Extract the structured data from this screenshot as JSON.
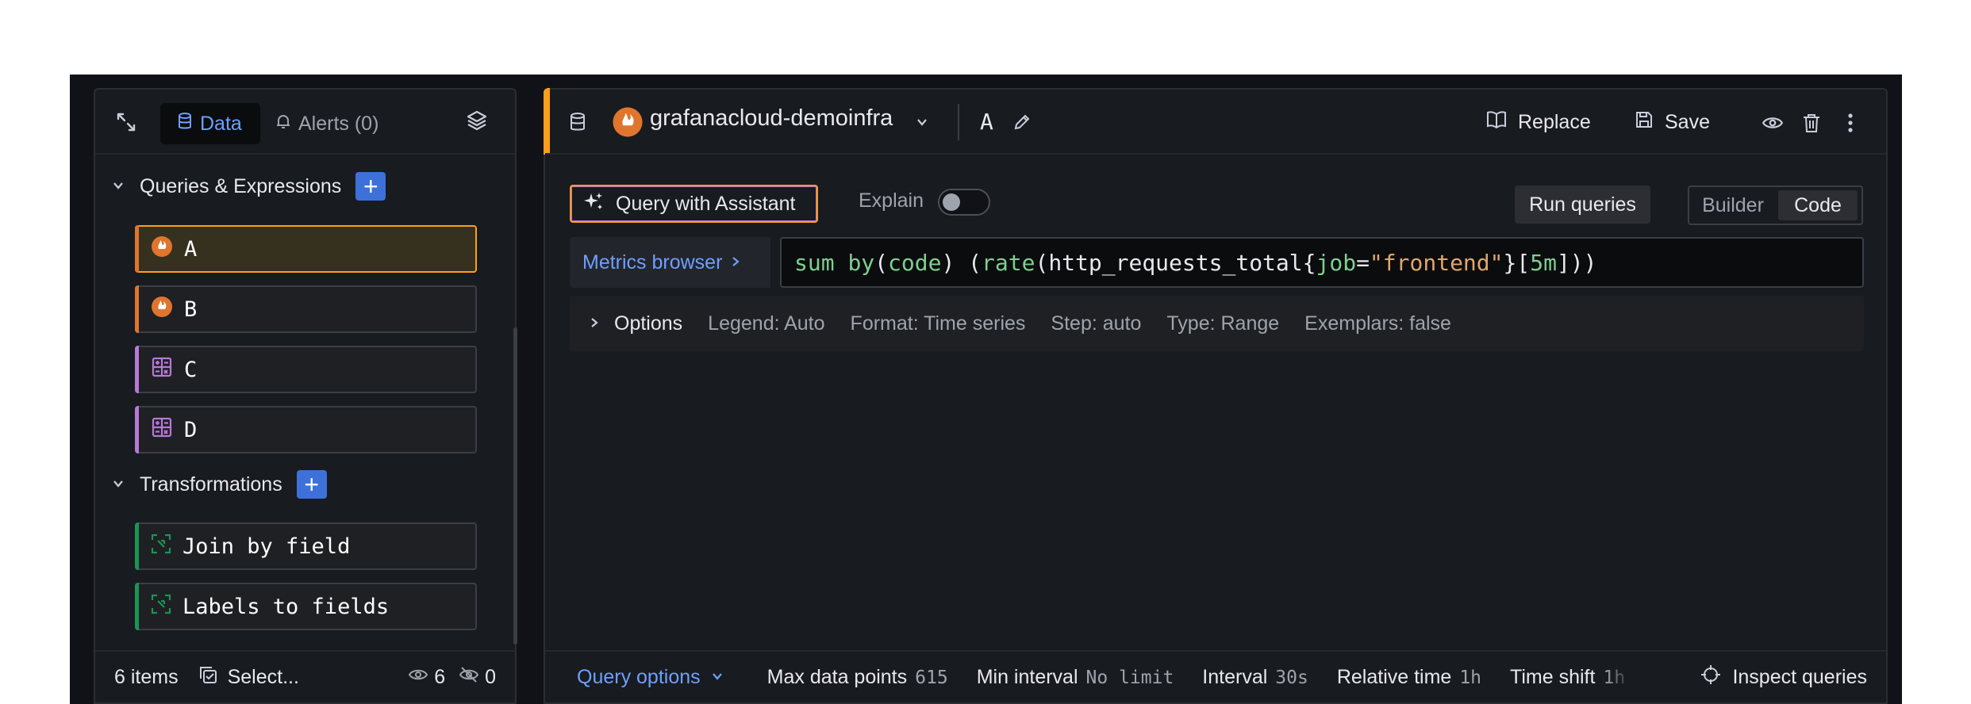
{
  "colors": {
    "accent": "#6e9fff",
    "selected_border": "#ff9e1a",
    "prometheus": "#e0752d",
    "expression": "#b877d9",
    "transformation": "#1a9456",
    "primary_button": "#3d71d9"
  },
  "left_panel": {
    "tabs": {
      "data_label": "Data",
      "alerts_label": "Alerts (0)"
    },
    "queries_section": {
      "title": "Queries & Expressions"
    },
    "queries": [
      {
        "label": "A",
        "icon": "prometheus-icon",
        "selected": true
      },
      {
        "label": "B",
        "icon": "prometheus-icon",
        "selected": false
      },
      {
        "label": "C",
        "icon": "math-expression-icon",
        "selected": false
      },
      {
        "label": "D",
        "icon": "math-expression-icon",
        "selected": false
      }
    ],
    "transformations_section": {
      "title": "Transformations"
    },
    "transformations": [
      {
        "label": "Join by field",
        "icon": "transform-icon"
      },
      {
        "label": "Labels to fields",
        "icon": "transform-icon"
      }
    ],
    "footer": {
      "count": "6 items",
      "select_label": "Select...",
      "visible_count": "6",
      "hidden_count": "0"
    }
  },
  "query_editor": {
    "datasource": "grafanacloud-demoinfra",
    "query_name": "A",
    "header_actions": {
      "replace": "Replace",
      "save": "Save"
    },
    "assistant_button": "Query with Assistant",
    "explain_label": "Explain",
    "explain_enabled": false,
    "run_queries": "Run queries",
    "mode": {
      "builder": "Builder",
      "code": "Code",
      "active": "Code"
    },
    "metrics_browser": "Metrics browser",
    "query_tokens": [
      {
        "text": "sum ",
        "color": "#7ecf90"
      },
      {
        "text": "by",
        "color": "#7ecf90"
      },
      {
        "text": "(",
        "color": "#e8e8ee"
      },
      {
        "text": "code",
        "color": "#7ecf90"
      },
      {
        "text": ") (",
        "color": "#e8e8ee"
      },
      {
        "text": "rate",
        "color": "#7ecf90"
      },
      {
        "text": "(http_requests_total{",
        "color": "#e8e8ee"
      },
      {
        "text": "job",
        "color": "#7ecf90"
      },
      {
        "text": "=",
        "color": "#e8e8ee"
      },
      {
        "text": "\"frontend\"",
        "color": "#e0a66b"
      },
      {
        "text": "}[",
        "color": "#e8e8ee"
      },
      {
        "text": "5m",
        "color": "#7ecf90"
      },
      {
        "text": "]))",
        "color": "#e8e8ee"
      }
    ],
    "options": {
      "title": "Options",
      "legend": "Legend: Auto",
      "format": "Format: Time series",
      "step": "Step: auto",
      "type": "Type: Range",
      "exemplars": "Exemplars: false"
    },
    "footer": {
      "query_options": "Query options",
      "max_data_points_label": "Max data points",
      "max_data_points_value": "615",
      "min_interval_label": "Min interval",
      "min_interval_value": "No limit",
      "interval_label": "Interval",
      "interval_value": "30s",
      "relative_time_label": "Relative time",
      "relative_time_value": "1h",
      "time_shift_label": "Time shift",
      "time_shift_value": "1h",
      "inspect": "Inspect queries"
    }
  }
}
